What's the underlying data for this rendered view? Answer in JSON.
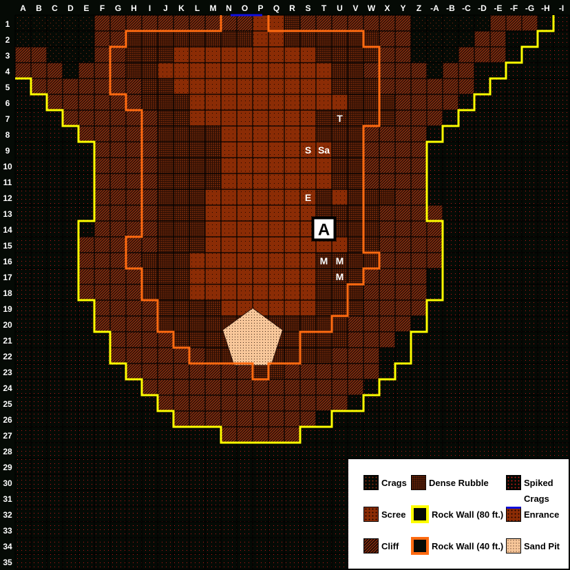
{
  "map": {
    "columns": [
      "A",
      "B",
      "C",
      "D",
      "E",
      "F",
      "G",
      "H",
      "I",
      "J",
      "K",
      "L",
      "M",
      "N",
      "O",
      "P",
      "Q",
      "R",
      "S",
      "T",
      "U",
      "V",
      "W",
      "X",
      "Y",
      "Z",
      "-A",
      "-B",
      "-C",
      "-D",
      "-E",
      "-F",
      "-G",
      "-H",
      "-I"
    ],
    "rows": [
      "1",
      "2",
      "3",
      "4",
      "5",
      "6",
      "7",
      "8",
      "9",
      "10",
      "11",
      "12",
      "13",
      "14",
      "15",
      "16",
      "17",
      "18",
      "19",
      "20",
      "21",
      "22",
      "23",
      "24",
      "25",
      "26",
      "27",
      "28",
      "29",
      "30",
      "31",
      "32",
      "33",
      "34",
      "35"
    ],
    "terrain_key": {
      "c": "crags",
      "s": "spiked-crags",
      "f": "cliff",
      "d": "dense-rubble",
      "r": "scree",
      "e": "entrance"
    },
    "terrain": [
      "cccccffffffffffeedfffffffcccccfffss",
      "cccccffddddddddeeddddddffccccffssss",
      "ffcccffdddrrrrrrrrrddddffcccfffssss",
      "fffcfffddrrrrrrrrrrrddffffcffsssss",
      "sfffffffddrrrrrrrrrrdddffffffssssss",
      "ssffffffdddrrrrrrrrrrdddffffsssssss",
      "sssffffffddrrrrrrrrdddddfffssssssss",
      "ssssfffffddddrrrrrrdddffffsssssssss",
      "sssssffffddddrrrrrrrddffffsssssssss",
      "sssssffffddddrrrrrrrddffffsssssssss",
      "sssssffffddddrrrrrrrddffffsssssssss",
      "sssssffffdddrrrrrrrdrdddffsssssssss",
      "sssssffffdddrrrrrrrddddffffssssssss",
      "sssssffffdddrrrrrrrrdddffffssssssss",
      "ssssfffffdddrrrrrrrrrddffffssssssss",
      "ssssffffdddrrrrrrrrddddffffssssssss",
      "ssssffffdddrrrrrrrrdddffffsssssssss",
      "ssssffffdddrrrrrrrrdddffffsssssssss",
      "sssssffffddddrrrrrrdddffffsssssssss",
      "sssssffffddddddddddddffffssssssssss",
      "ssssssffffdddddddddddfffsssssssssss",
      "ssssssffffffddddddddfffssssssssssss",
      "sssssssffffffffddffffffssssssssssss",
      "ssssssssffffffffffffffsssssssssssss",
      "sssssssssffffffffffffssssssssssssss",
      "ssssssssssfffffffffssssssssssssssss",
      "sssssssssssssfffffsssssssssssssssss",
      "sssssssssssssssssssssssssssssssssss",
      "sssssssssssssssssssssssssssssssssss",
      "sssssssssssssssssssssssssssssssssss",
      "sssssssssssssssssssssssssssssssssss",
      "sssssssssssssssssssssssssssssssssss",
      "sssssssssssssssssssssssssssssssssss",
      "sssssssssssssssssssssssssssssssssss",
      "sssssssssssssssssssssssssssssssssss"
    ],
    "walls": [
      {
        "type": "rock-wall-80ft",
        "points": [
          [
            0,
            4
          ],
          [
            1,
            4
          ],
          [
            1,
            5
          ],
          [
            2,
            5
          ],
          [
            2,
            6
          ],
          [
            3,
            6
          ],
          [
            3,
            7
          ],
          [
            4,
            7
          ],
          [
            4,
            8
          ],
          [
            5,
            8
          ],
          [
            5,
            13
          ],
          [
            4,
            13
          ],
          [
            4,
            18
          ],
          [
            5,
            18
          ],
          [
            5,
            20
          ],
          [
            6,
            20
          ],
          [
            6,
            22
          ],
          [
            7,
            22
          ],
          [
            7,
            23
          ],
          [
            8,
            23
          ],
          [
            8,
            24
          ],
          [
            9,
            24
          ],
          [
            9,
            25
          ],
          [
            10,
            25
          ],
          [
            10,
            26
          ],
          [
            13,
            26
          ],
          [
            13,
            27
          ],
          [
            18,
            27
          ],
          [
            18,
            26
          ],
          [
            20,
            26
          ],
          [
            20,
            25
          ],
          [
            22,
            25
          ],
          [
            22,
            24
          ],
          [
            23,
            24
          ],
          [
            23,
            23
          ],
          [
            24,
            23
          ],
          [
            24,
            22
          ],
          [
            25,
            22
          ],
          [
            25,
            20
          ],
          [
            26,
            20
          ],
          [
            26,
            18
          ],
          [
            27,
            18
          ],
          [
            27,
            13
          ],
          [
            26,
            13
          ],
          [
            26,
            8
          ],
          [
            27,
            8
          ],
          [
            27,
            7
          ],
          [
            28,
            7
          ],
          [
            28,
            6
          ],
          [
            29,
            6
          ],
          [
            29,
            5
          ],
          [
            30,
            5
          ],
          [
            30,
            4
          ],
          [
            31,
            4
          ],
          [
            31,
            3
          ],
          [
            32,
            3
          ],
          [
            32,
            2
          ],
          [
            33,
            2
          ],
          [
            33,
            1
          ],
          [
            34,
            1
          ],
          [
            34,
            0
          ]
        ]
      },
      {
        "type": "rock-wall-40ft",
        "points": [
          [
            13,
            0
          ],
          [
            13,
            1
          ],
          [
            7,
            1
          ],
          [
            7,
            2
          ],
          [
            6,
            2
          ],
          [
            6,
            5
          ],
          [
            7,
            5
          ],
          [
            7,
            6
          ],
          [
            8,
            6
          ],
          [
            8,
            14
          ],
          [
            7,
            14
          ],
          [
            7,
            16
          ],
          [
            8,
            16
          ],
          [
            8,
            18
          ],
          [
            9,
            18
          ],
          [
            9,
            20
          ],
          [
            10,
            20
          ],
          [
            10,
            21
          ],
          [
            11,
            21
          ],
          [
            11,
            22
          ],
          [
            15,
            22
          ],
          [
            15,
            23
          ],
          [
            16,
            23
          ],
          [
            16,
            22
          ],
          [
            18,
            22
          ],
          [
            18,
            20
          ],
          [
            20,
            20
          ],
          [
            20,
            19
          ],
          [
            21,
            19
          ],
          [
            21,
            17
          ],
          [
            22,
            17
          ],
          [
            22,
            16
          ],
          [
            23,
            16
          ],
          [
            23,
            15
          ],
          [
            22,
            15
          ],
          [
            22,
            7
          ],
          [
            23,
            7
          ],
          [
            23,
            2
          ],
          [
            22,
            2
          ],
          [
            22,
            1
          ],
          [
            16,
            1
          ],
          [
            16,
            0
          ]
        ]
      }
    ],
    "entrance_edge": {
      "from": [
        14,
        0
      ],
      "to": [
        16,
        0
      ]
    },
    "sand_pit": {
      "center": [
        15,
        20.5
      ],
      "radius": 2.0
    },
    "markers": [
      {
        "label": "T",
        "col": 20,
        "row": 6
      },
      {
        "label": "S",
        "col": 18,
        "row": 8
      },
      {
        "label": "Sa",
        "col": 19,
        "row": 8
      },
      {
        "label": "E",
        "col": 18,
        "row": 11
      },
      {
        "label": "M",
        "col": 19,
        "row": 15
      },
      {
        "label": "M",
        "col": 20,
        "row": 15
      },
      {
        "label": "M",
        "col": 20,
        "row": 16
      }
    ],
    "token": {
      "label": "A",
      "col": 19.5,
      "row": 13
    }
  },
  "colors": {
    "background": "#050a05",
    "crags_dot": "#8a2a10",
    "spiked_dot": "#c41818",
    "cliff": "#7a2a10",
    "dense_rubble": "#5a2008",
    "scree": "#8b2c05",
    "sand": "#f8c79a",
    "wall80": "#ffff00",
    "wall40": "#ff6a10",
    "entrance": "#1010e0"
  },
  "legend": {
    "items": [
      {
        "key": "crags",
        "label": "Crags"
      },
      {
        "key": "dense-rubble",
        "label": "Dense Rubble"
      },
      {
        "key": "spiked-crags",
        "label": "Spiked"
      },
      {
        "key": "scree",
        "label": "Scree"
      },
      {
        "key": "rock-wall-80ft",
        "label": "Rock Wall (80 ft.)"
      },
      {
        "key": "entrance",
        "label": "Enrance"
      },
      {
        "key": "cliff",
        "label": "Cliff"
      },
      {
        "key": "rock-wall-40ft",
        "label": "Rock Wall (40 ft.)"
      },
      {
        "key": "sand-pit",
        "label": "Sand Pit"
      }
    ],
    "spiked_second_line": "Crags"
  }
}
